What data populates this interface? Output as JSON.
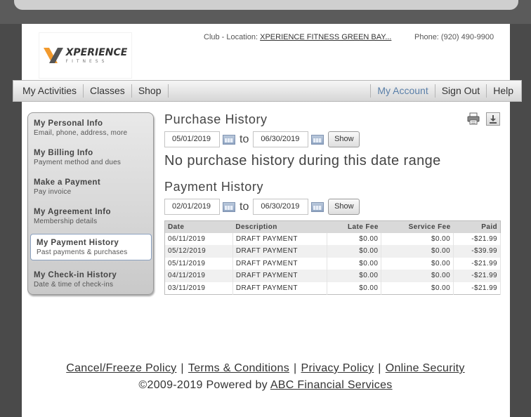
{
  "logo": {
    "word": "XPERIENCE",
    "sub": "FITNESS"
  },
  "header": {
    "club_prefix": "Club - Location: ",
    "club_name": "XPERIENCE FITNESS GREEN BAY...",
    "phone": "Phone: (920) 490-9900"
  },
  "nav": {
    "left": [
      "My Activities",
      "Classes",
      "Shop"
    ],
    "right": [
      "My Account",
      "Sign Out",
      "Help"
    ]
  },
  "sidebar": {
    "items": [
      {
        "title": "My Personal Info",
        "sub": "Email, phone, address, more"
      },
      {
        "title": "My Billing Info",
        "sub": "Payment method and dues"
      },
      {
        "title": "Make a Payment",
        "sub": "Pay invoice"
      },
      {
        "title": "My Agreement Info",
        "sub": "Membership details"
      },
      {
        "title": "My Payment History",
        "sub": "Past payments & purchases"
      },
      {
        "title": "My Check-in History",
        "sub": "Date & time of check-ins"
      }
    ]
  },
  "purchase": {
    "heading": "Purchase History",
    "from": "05/01/2019",
    "to_label": "to",
    "to": "06/30/2019",
    "show": "Show",
    "empty": "No purchase history during this date range"
  },
  "payment": {
    "heading": "Payment History",
    "from": "02/01/2019",
    "to_label": "to",
    "to": "06/30/2019",
    "show": "Show",
    "columns": [
      "Date",
      "Description",
      "Late Fee",
      "Service Fee",
      "Paid"
    ],
    "rows": [
      [
        "06/11/2019",
        "DRAFT PAYMENT",
        "$0.00",
        "$0.00",
        "-$21.99"
      ],
      [
        "05/12/2019",
        "DRAFT PAYMENT",
        "$0.00",
        "$0.00",
        "-$39.99"
      ],
      [
        "05/11/2019",
        "DRAFT PAYMENT",
        "$0.00",
        "$0.00",
        "-$21.99"
      ],
      [
        "04/11/2019",
        "DRAFT PAYMENT",
        "$0.00",
        "$0.00",
        "-$21.99"
      ],
      [
        "03/11/2019",
        "DRAFT PAYMENT",
        "$0.00",
        "$0.00",
        "-$21.99"
      ]
    ]
  },
  "footer": {
    "links": [
      "Cancel/Freeze Policy",
      "Terms & Conditions",
      "Privacy Policy",
      "Online Security"
    ],
    "separator": "|",
    "copy_prefix": "©2009-2019 Powered by ",
    "copy_link": "ABC Financial Services"
  },
  "colors": {
    "accent_link": "#5a7fa8",
    "logo_orange": "#f29a2e",
    "logo_gray": "#555555"
  }
}
